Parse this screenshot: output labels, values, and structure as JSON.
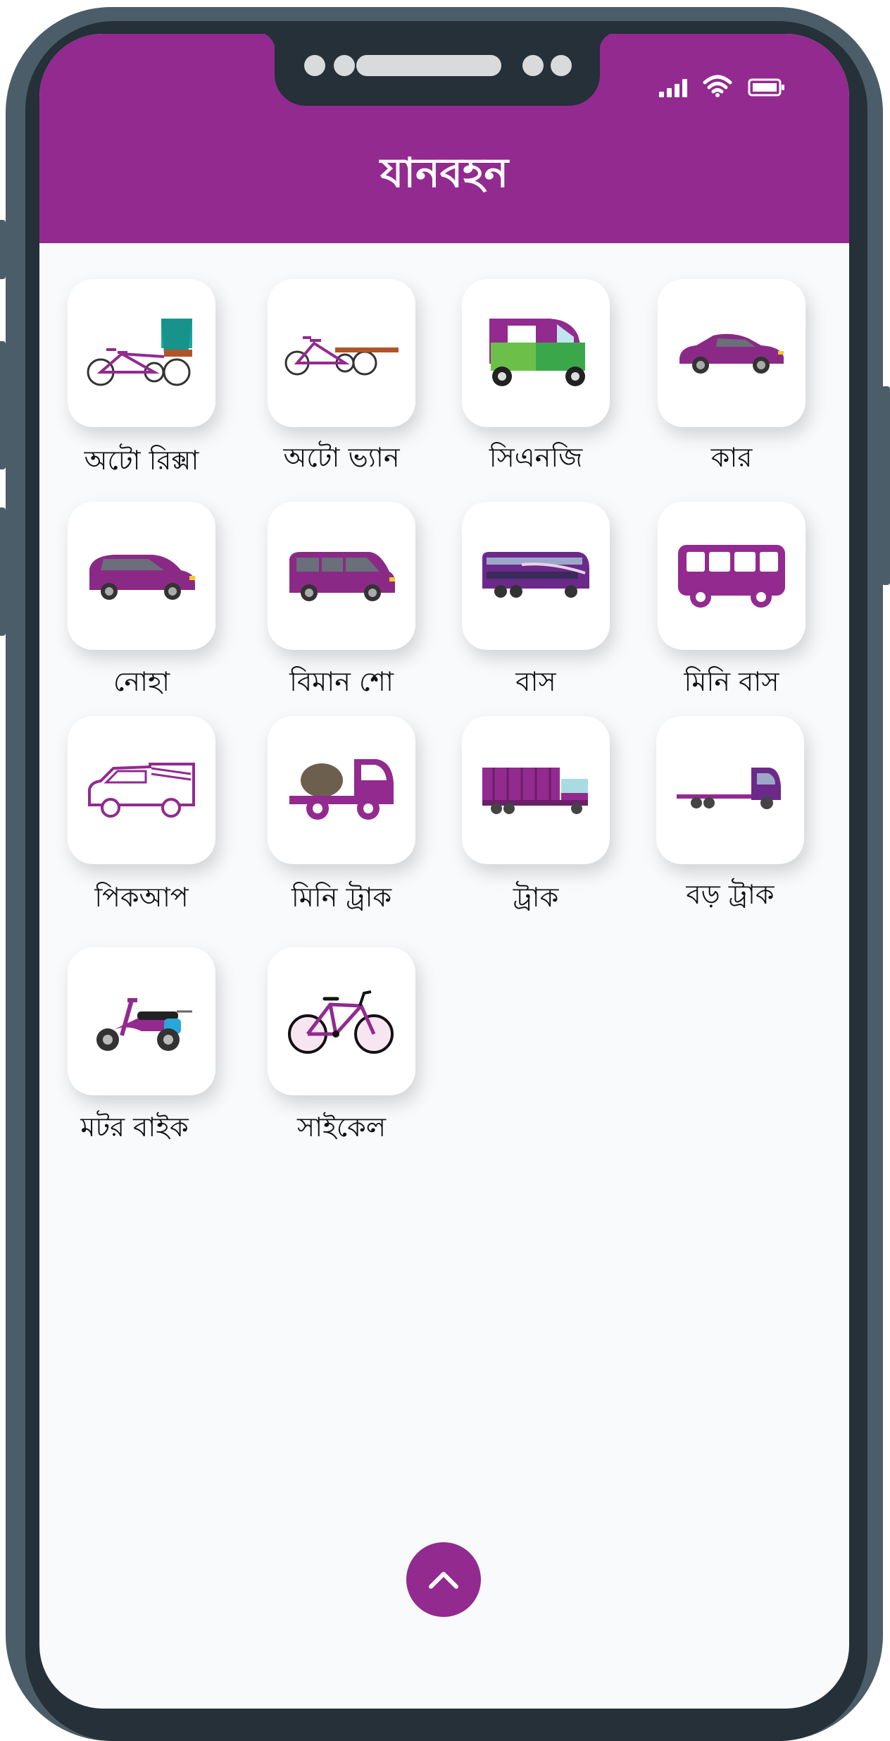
{
  "header": {
    "title": "যানবহন",
    "background": "#922a8f"
  },
  "status_bar": {
    "icons": [
      "signal-icon",
      "wifi-icon",
      "battery-icon"
    ]
  },
  "vehicles": [
    {
      "label": "অটো রিক্সা",
      "icon": "auto-rickshaw-icon"
    },
    {
      "label": "অটো ভ্যান",
      "icon": "auto-van-icon"
    },
    {
      "label": "সিএনজি",
      "icon": "cng-icon"
    },
    {
      "label": "কার",
      "icon": "car-icon"
    },
    {
      "label": "নোহা",
      "icon": "noah-icon"
    },
    {
      "label": "বিমান শো",
      "icon": "minivan-icon"
    },
    {
      "label": "বাস",
      "icon": "bus-icon"
    },
    {
      "label": "মিনি বাস",
      "icon": "mini-bus-icon"
    },
    {
      "label": "পিকআপ",
      "icon": "pickup-icon"
    },
    {
      "label": "মিনি ট্রাক",
      "icon": "mini-truck-icon"
    },
    {
      "label": "ট্রাক",
      "icon": "truck-icon"
    },
    {
      "label": "বড় ট্রাক",
      "icon": "big-truck-icon"
    },
    {
      "label": "মটর বাইক",
      "icon": "motorbike-icon"
    },
    {
      "label": "সাইকেল",
      "icon": "bicycle-icon"
    }
  ],
  "scroll_button": {
    "icon": "chevron-up-icon"
  },
  "colors": {
    "accent": "#922a8f",
    "frame": "#4b5d69",
    "bezel": "#253038",
    "screen_bg": "#f9fafc"
  }
}
